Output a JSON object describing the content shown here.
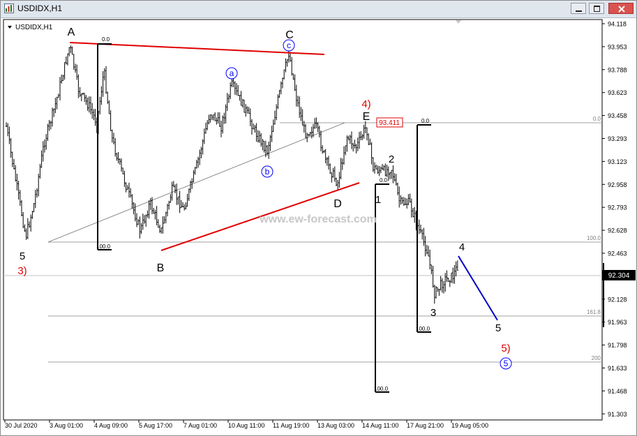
{
  "window": {
    "title": "USDIDX,H1",
    "chart_label": "USDIDX,H1",
    "watermark": "www.ew-forecast.com",
    "current_price": "92.304",
    "level_box_value": "93.411"
  },
  "axis": {
    "y_ticks": [
      "94.118",
      "93.953",
      "93.788",
      "93.623",
      "93.458",
      "93.293",
      "93.123",
      "92.958",
      "92.793",
      "92.628",
      "92.463",
      "92.298",
      "92.128",
      "91.963",
      "91.798",
      "91.633",
      "91.468",
      "91.303"
    ],
    "x_ticks": [
      "30 Jul 2020",
      "3 Aug 01:00",
      "4 Aug 09:00",
      "5 Aug 17:00",
      "7 Aug 01:00",
      "10 Aug 11:00",
      "11 Aug 19:00",
      "13 Aug 03:00",
      "14 Aug 11:00",
      "17 Aug 21:00",
      "19 Aug 05:00"
    ]
  },
  "fib_labels": {
    "level_0": "0.0",
    "level_100": "100.0",
    "level_161": "161.8",
    "level_200": "200",
    "box1_top": "0.0",
    "box1_bottom": "100.0",
    "box2_top": "0.0",
    "box2_bottom": "100.0",
    "box3_top": "0.0",
    "box3_bottom": "100.0"
  },
  "wave_labels": {
    "five_low": "5",
    "three_red": "3)",
    "A": "A",
    "B": "B",
    "C": "C",
    "c_circle": "c",
    "a_circle": "a",
    "b_circle": "b",
    "D": "D",
    "E": "E",
    "four_red": "4)",
    "one": "1",
    "two": "2",
    "three": "3",
    "four": "4",
    "five_proj": "5",
    "five_red": "5)",
    "five_circle": "5"
  },
  "colors": {
    "candles": "#000000",
    "triangle_red": "#e00000",
    "projection_blue": "#0000c8",
    "circle_blue": "#0000ff",
    "grid_gray": "#a0a0a0",
    "box_red": "#e00000"
  }
}
